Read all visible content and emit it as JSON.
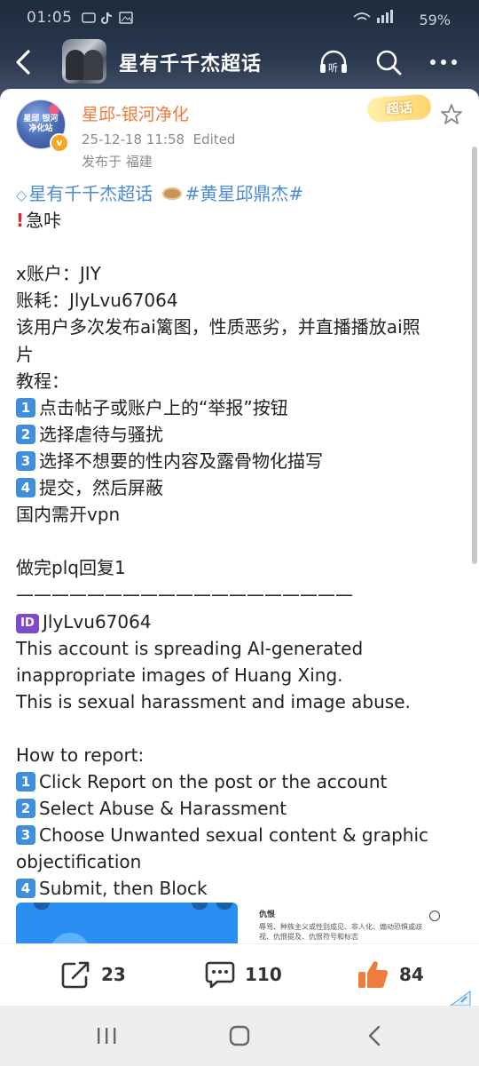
{
  "status_bar": {
    "time": "01:05",
    "battery": "59%"
  },
  "header": {
    "title": "星有千千杰超话",
    "back_icon": "chevron-left-icon"
  },
  "post": {
    "username": "星邱-银河净化",
    "avatar_text": "星邱 银河净化站",
    "timestamp": "25-12-18 11:58",
    "edited": "Edited",
    "location": "发布于 福建",
    "supertopic_badge": "超话",
    "lines": {
      "l1_link1": "星有千千杰超话",
      "l1_link2": "#黄星邱鼎杰#",
      "l2": "急咔",
      "l4": "x账户：JIY",
      "l5": "账耗：JlyLvu67064",
      "l6": "该用户多次发布ai篱图，性质恶劣，并直播播放ai照",
      "l7": "片",
      "l8": "教程：",
      "l9": "点击帖子或账户上的“举报”按钮",
      "l10": "选择虐待与骚扰",
      "l11": "选择不想要的性内容及露骨物化描写",
      "l12": "提交，然后屏蔽",
      "l13": "国内需开vpn",
      "l15": "做完plq回复1",
      "l16": "———————————————————",
      "l17": "JlyLvu67064",
      "l18": "This account is spreading AI-generated",
      "l19": "inappropriate images of Huang Xing.",
      "l20": "This is sexual harassment and image abuse.",
      "l22": "How to report:",
      "l23": "Click Report on the post or the account",
      "l24": "Select Abuse & Harassment",
      "l25": "Choose Unwanted sexual content & graphic",
      "l26": "objectification",
      "l27": "Submit, then Block"
    },
    "keycaps": [
      "1",
      "2",
      "3",
      "4"
    ],
    "id_badge": "ID",
    "image_preview_title": "仇恨",
    "image_preview_text": "辱骂、种族主义或性别成见、非人化、煽动恐惧或歧视、仇恨提及、仇恨符号和标志"
  },
  "actions": {
    "repost_count": "23",
    "comment_count": "110",
    "like_count": "84"
  },
  "colors": {
    "accent_orange": "#ee7a3a",
    "link_blue": "#4a8ad9",
    "header_dark": "#2b3950"
  }
}
